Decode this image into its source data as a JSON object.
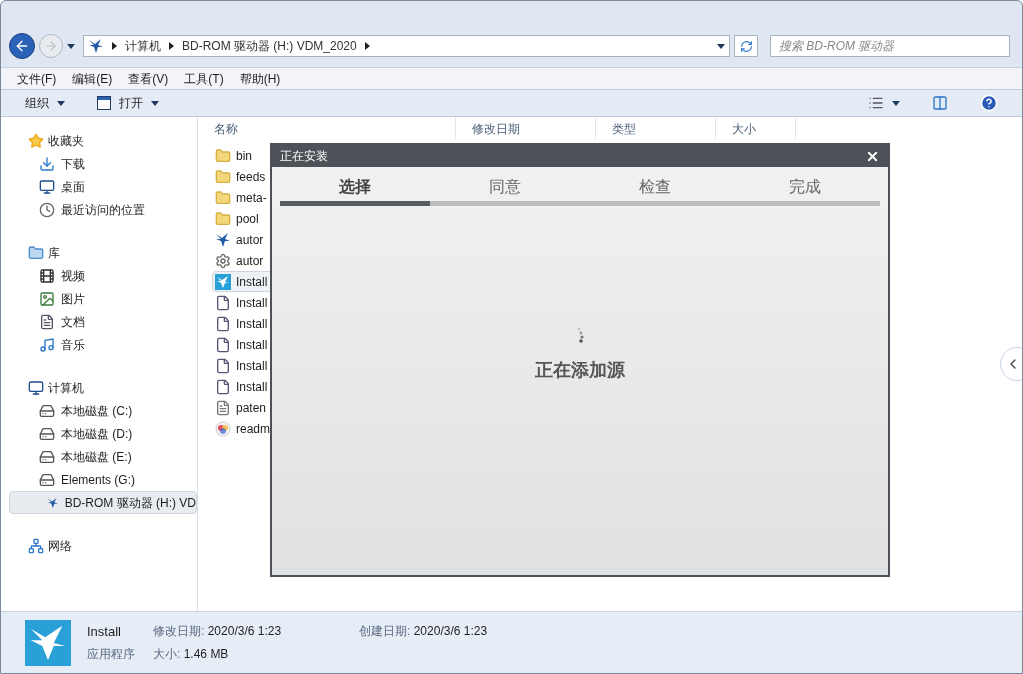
{
  "address_bar": {
    "crumbs": [
      "计算机",
      "BD-ROM 驱动器 (H:) VDM_2020"
    ]
  },
  "search": {
    "placeholder": "搜索 BD-ROM 驱动器"
  },
  "menu": [
    "文件(F)",
    "编辑(E)",
    "查看(V)",
    "工具(T)",
    "帮助(H)"
  ],
  "toolbar": {
    "organize": "组织",
    "open": "打开"
  },
  "sidebar": {
    "groups": [
      {
        "label": "收藏夹",
        "kind": "star",
        "items": [
          {
            "label": "下载",
            "kind": "download",
            "selected": false
          },
          {
            "label": "桌面",
            "kind": "desktop",
            "selected": false
          },
          {
            "label": "最近访问的位置",
            "kind": "recent",
            "selected": false
          }
        ]
      },
      {
        "label": "库",
        "kind": "library",
        "items": [
          {
            "label": "视频",
            "kind": "video",
            "selected": false
          },
          {
            "label": "图片",
            "kind": "picture",
            "selected": false
          },
          {
            "label": "文档",
            "kind": "document",
            "selected": false
          },
          {
            "label": "音乐",
            "kind": "music",
            "selected": false
          }
        ]
      },
      {
        "label": "计算机",
        "kind": "computer",
        "items": [
          {
            "label": "本地磁盘 (C:)",
            "kind": "drive",
            "selected": false
          },
          {
            "label": "本地磁盘 (D:)",
            "kind": "drive",
            "selected": false
          },
          {
            "label": "本地磁盘 (E:)",
            "kind": "drive",
            "selected": false
          },
          {
            "label": "Elements (G:)",
            "kind": "drive",
            "selected": false
          },
          {
            "label": "BD-ROM 驱动器 (H:) VD",
            "kind": "disc",
            "selected": true
          }
        ]
      },
      {
        "label": "网络",
        "kind": "network"
      }
    ]
  },
  "file_list": {
    "columns": [
      "名称",
      "修改日期",
      "类型",
      "大小"
    ],
    "files": [
      {
        "name": "bin",
        "kind": "folder",
        "selected": false
      },
      {
        "name": "feeds",
        "kind": "folder",
        "selected": false
      },
      {
        "name": "meta-",
        "kind": "folder",
        "selected": false
      },
      {
        "name": "pool",
        "kind": "folder",
        "selected": false
      },
      {
        "name": "autor",
        "kind": "app",
        "selected": false
      },
      {
        "name": "autor",
        "kind": "settings",
        "selected": false
      },
      {
        "name": "Install",
        "kind": "installer",
        "selected": true
      },
      {
        "name": "Install",
        "kind": "config",
        "selected": false
      },
      {
        "name": "Install",
        "kind": "config",
        "selected": false
      },
      {
        "name": "Install",
        "kind": "config",
        "selected": false
      },
      {
        "name": "Install",
        "kind": "config",
        "selected": false
      },
      {
        "name": "Install",
        "kind": "config",
        "selected": false
      },
      {
        "name": "paten",
        "kind": "text",
        "selected": false
      },
      {
        "name": "readm",
        "kind": "image",
        "selected": false
      }
    ]
  },
  "dialog": {
    "title": "正在安装",
    "steps": [
      {
        "label": "选择",
        "selected": true
      },
      {
        "label": "同意",
        "selected": false
      },
      {
        "label": "检查",
        "selected": false
      },
      {
        "label": "完成",
        "selected": false
      }
    ],
    "status": "正在添加源"
  },
  "details": {
    "name": "Install",
    "type": "应用程序",
    "fields": [
      {
        "label": "修改日期:",
        "value": "2020/3/6 1:23"
      },
      {
        "label": "创建日期:",
        "value": "2020/3/6 1:23"
      },
      {
        "label": "大小:",
        "value": "1.46 MB"
      }
    ]
  }
}
